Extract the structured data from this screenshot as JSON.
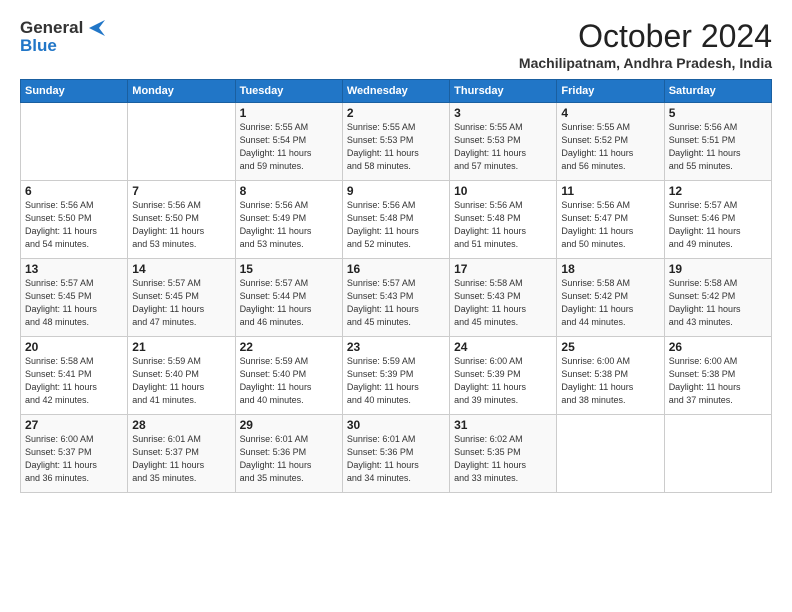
{
  "logo": {
    "line1": "General",
    "line2": "Blue"
  },
  "title": "October 2024",
  "location": "Machilipatnam, Andhra Pradesh, India",
  "header_days": [
    "Sunday",
    "Monday",
    "Tuesday",
    "Wednesday",
    "Thursday",
    "Friday",
    "Saturday"
  ],
  "weeks": [
    [
      {
        "day": "",
        "info": ""
      },
      {
        "day": "",
        "info": ""
      },
      {
        "day": "1",
        "info": "Sunrise: 5:55 AM\nSunset: 5:54 PM\nDaylight: 11 hours\nand 59 minutes."
      },
      {
        "day": "2",
        "info": "Sunrise: 5:55 AM\nSunset: 5:53 PM\nDaylight: 11 hours\nand 58 minutes."
      },
      {
        "day": "3",
        "info": "Sunrise: 5:55 AM\nSunset: 5:53 PM\nDaylight: 11 hours\nand 57 minutes."
      },
      {
        "day": "4",
        "info": "Sunrise: 5:55 AM\nSunset: 5:52 PM\nDaylight: 11 hours\nand 56 minutes."
      },
      {
        "day": "5",
        "info": "Sunrise: 5:56 AM\nSunset: 5:51 PM\nDaylight: 11 hours\nand 55 minutes."
      }
    ],
    [
      {
        "day": "6",
        "info": "Sunrise: 5:56 AM\nSunset: 5:50 PM\nDaylight: 11 hours\nand 54 minutes."
      },
      {
        "day": "7",
        "info": "Sunrise: 5:56 AM\nSunset: 5:50 PM\nDaylight: 11 hours\nand 53 minutes."
      },
      {
        "day": "8",
        "info": "Sunrise: 5:56 AM\nSunset: 5:49 PM\nDaylight: 11 hours\nand 53 minutes."
      },
      {
        "day": "9",
        "info": "Sunrise: 5:56 AM\nSunset: 5:48 PM\nDaylight: 11 hours\nand 52 minutes."
      },
      {
        "day": "10",
        "info": "Sunrise: 5:56 AM\nSunset: 5:48 PM\nDaylight: 11 hours\nand 51 minutes."
      },
      {
        "day": "11",
        "info": "Sunrise: 5:56 AM\nSunset: 5:47 PM\nDaylight: 11 hours\nand 50 minutes."
      },
      {
        "day": "12",
        "info": "Sunrise: 5:57 AM\nSunset: 5:46 PM\nDaylight: 11 hours\nand 49 minutes."
      }
    ],
    [
      {
        "day": "13",
        "info": "Sunrise: 5:57 AM\nSunset: 5:45 PM\nDaylight: 11 hours\nand 48 minutes."
      },
      {
        "day": "14",
        "info": "Sunrise: 5:57 AM\nSunset: 5:45 PM\nDaylight: 11 hours\nand 47 minutes."
      },
      {
        "day": "15",
        "info": "Sunrise: 5:57 AM\nSunset: 5:44 PM\nDaylight: 11 hours\nand 46 minutes."
      },
      {
        "day": "16",
        "info": "Sunrise: 5:57 AM\nSunset: 5:43 PM\nDaylight: 11 hours\nand 45 minutes."
      },
      {
        "day": "17",
        "info": "Sunrise: 5:58 AM\nSunset: 5:43 PM\nDaylight: 11 hours\nand 45 minutes."
      },
      {
        "day": "18",
        "info": "Sunrise: 5:58 AM\nSunset: 5:42 PM\nDaylight: 11 hours\nand 44 minutes."
      },
      {
        "day": "19",
        "info": "Sunrise: 5:58 AM\nSunset: 5:42 PM\nDaylight: 11 hours\nand 43 minutes."
      }
    ],
    [
      {
        "day": "20",
        "info": "Sunrise: 5:58 AM\nSunset: 5:41 PM\nDaylight: 11 hours\nand 42 minutes."
      },
      {
        "day": "21",
        "info": "Sunrise: 5:59 AM\nSunset: 5:40 PM\nDaylight: 11 hours\nand 41 minutes."
      },
      {
        "day": "22",
        "info": "Sunrise: 5:59 AM\nSunset: 5:40 PM\nDaylight: 11 hours\nand 40 minutes."
      },
      {
        "day": "23",
        "info": "Sunrise: 5:59 AM\nSunset: 5:39 PM\nDaylight: 11 hours\nand 40 minutes."
      },
      {
        "day": "24",
        "info": "Sunrise: 6:00 AM\nSunset: 5:39 PM\nDaylight: 11 hours\nand 39 minutes."
      },
      {
        "day": "25",
        "info": "Sunrise: 6:00 AM\nSunset: 5:38 PM\nDaylight: 11 hours\nand 38 minutes."
      },
      {
        "day": "26",
        "info": "Sunrise: 6:00 AM\nSunset: 5:38 PM\nDaylight: 11 hours\nand 37 minutes."
      }
    ],
    [
      {
        "day": "27",
        "info": "Sunrise: 6:00 AM\nSunset: 5:37 PM\nDaylight: 11 hours\nand 36 minutes."
      },
      {
        "day": "28",
        "info": "Sunrise: 6:01 AM\nSunset: 5:37 PM\nDaylight: 11 hours\nand 35 minutes."
      },
      {
        "day": "29",
        "info": "Sunrise: 6:01 AM\nSunset: 5:36 PM\nDaylight: 11 hours\nand 35 minutes."
      },
      {
        "day": "30",
        "info": "Sunrise: 6:01 AM\nSunset: 5:36 PM\nDaylight: 11 hours\nand 34 minutes."
      },
      {
        "day": "31",
        "info": "Sunrise: 6:02 AM\nSunset: 5:35 PM\nDaylight: 11 hours\nand 33 minutes."
      },
      {
        "day": "",
        "info": ""
      },
      {
        "day": "",
        "info": ""
      }
    ]
  ]
}
